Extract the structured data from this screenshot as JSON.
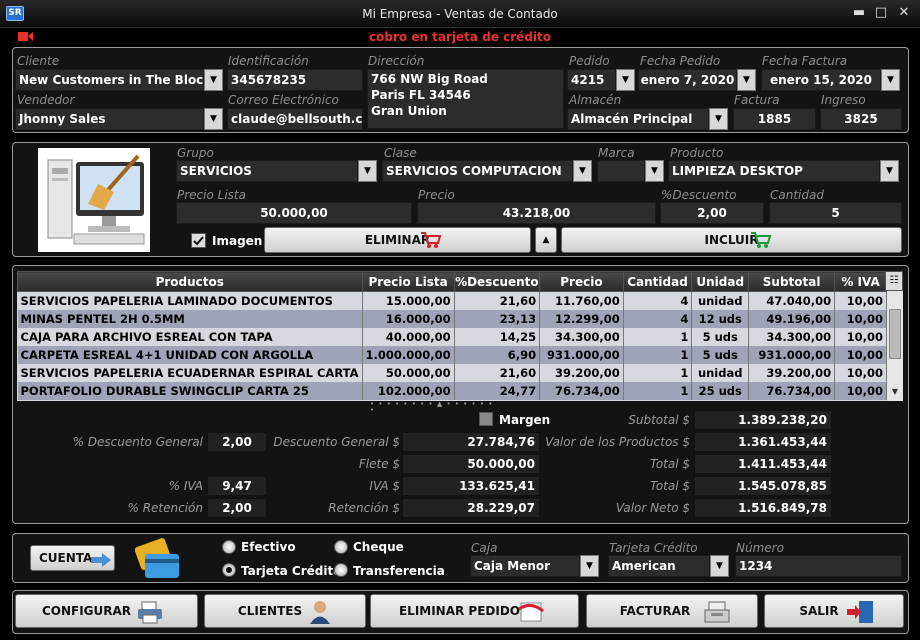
{
  "window": {
    "title": "Mi Empresa - Ventas de Contado",
    "logo": "SR",
    "minimize": "▬",
    "maximize": "□",
    "close": "✕"
  },
  "alert": "cobro en tarjeta de crédito",
  "header": {
    "cliente_label": "Cliente",
    "cliente": "New Customers in The Block",
    "ident_label": "Identificación",
    "ident": "345678235",
    "direccion_label": "Dirección",
    "direccion": [
      "766 NW Big Road",
      "Paris FL 34546",
      "Gran Union"
    ],
    "pedido_label": "Pedido",
    "pedido": "4215",
    "fecha_pedido_label": "Fecha Pedido",
    "fecha_pedido": "enero 7, 2020",
    "fecha_factura_label": "Fecha Factura",
    "fecha_factura": "enero 15, 2020",
    "vendedor_label": "Vendedor",
    "vendedor": "Jhonny Sales",
    "correo_label": "Correo Electrónico",
    "correo": "claude@bellsouth.com",
    "almacen_label": "Almacén",
    "almacen": "Almacén Principal",
    "factura_label": "Factura",
    "factura": "1885",
    "ingreso_label": "Ingreso",
    "ingreso": "3825"
  },
  "product": {
    "grupo_label": "Grupo",
    "grupo": "SERVICIOS",
    "clase_label": "Clase",
    "clase": "SERVICIOS COMPUTACION",
    "marca_label": "Marca",
    "marca": "",
    "producto_label": "Producto",
    "producto": "LIMPIEZA DESKTOP",
    "precio_lista_label": "Precio Lista",
    "precio_lista": "50.000,00",
    "precio_label": "Precio",
    "precio": "43.218,00",
    "descuento_label": "%Descuento",
    "descuento": "2,00",
    "cantidad_label": "Cantidad",
    "cantidad": "5",
    "imagen_label": "Imagen",
    "imagen_checked": true,
    "eliminar": "ELIMINAR",
    "incluir": "INCLUIR"
  },
  "table": {
    "headers": [
      "Productos",
      "Precio Lista",
      "%Descuento",
      "Precio",
      "Cantidad",
      "Unidad",
      "Subtotal",
      "% IVA"
    ],
    "rows": [
      [
        "SERVICIOS PAPELERIA LAMINADO DOCUMENTOS",
        "15.000,00",
        "21,60",
        "11.760,00",
        "4",
        "unidad",
        "47.040,00",
        "10,00"
      ],
      [
        "MINAS PENTEL 2H 0.5MM",
        "16.000,00",
        "23,13",
        "12.299,00",
        "4",
        "12 uds",
        "49.196,00",
        "10,00"
      ],
      [
        "CAJA PARA ARCHIVO ESREAL CON TAPA",
        "40.000,00",
        "14,25",
        "34.300,00",
        "1",
        "5 uds",
        "34.300,00",
        "10,00"
      ],
      [
        "CARPETA ESREAL 4+1 UNIDAD CON ARGOLLA",
        "1.000.000,00",
        "6,90",
        "931.000,00",
        "1",
        "5 uds",
        "931.000,00",
        "10,00"
      ],
      [
        "SERVICIOS PAPELERIA ECUADERNAR ESPIRAL CARTA",
        "50.000,00",
        "21,60",
        "39.200,00",
        "1",
        "unidad",
        "39.200,00",
        "10,00"
      ],
      [
        "PORTAFOLIO DURABLE SWINGCLIP CARTA 25",
        "102.000,00",
        "24,77",
        "76.734,00",
        "1",
        "25 uds",
        "76.734,00",
        "10,00"
      ]
    ]
  },
  "totals": {
    "margen": "Margen",
    "desc_general_label": "% Descuento General",
    "desc_general": "2,00",
    "descuento_label": "Descuento General $",
    "descuento": "27.784,76",
    "flete_label": "Flete $",
    "flete": "50.000,00",
    "iva_pct_label": "% IVA",
    "iva_pct": "9,47",
    "iva_label": "IVA $",
    "iva": "133.625,41",
    "ret_pct_label": "% Retención",
    "ret_pct": "2,00",
    "ret_label": "Retención $",
    "ret": "28.229,07",
    "subtotal_label": "Subtotal $",
    "subtotal": "1.389.238,20",
    "valor_prod_label": "Valor de los Productos $",
    "valor_prod": "1.361.453,44",
    "total1_label": "Total $",
    "total1": "1.411.453,44",
    "total2_label": "Total $",
    "total2": "1.545.078,85",
    "neto_label": "Valor Neto $",
    "neto": "1.516.849,78"
  },
  "payment": {
    "cuenta": "CUENTA",
    "efectivo": "Efectivo",
    "cheque": "Cheque",
    "tarjeta": "Tarjeta Crédito",
    "transferencia": "Transferencia",
    "caja_label": "Caja",
    "caja": "Caja Menor",
    "tarjeta_label": "Tarjeta Crédito",
    "tarjeta_val": "American",
    "numero_label": "Número",
    "numero": "1234"
  },
  "footer": {
    "configurar": "CONFIGURAR",
    "clientes": "CLIENTES",
    "eliminar_pedido": "ELIMINAR PEDIDO",
    "facturar": "FACTURAR",
    "salir": "SALIR"
  }
}
